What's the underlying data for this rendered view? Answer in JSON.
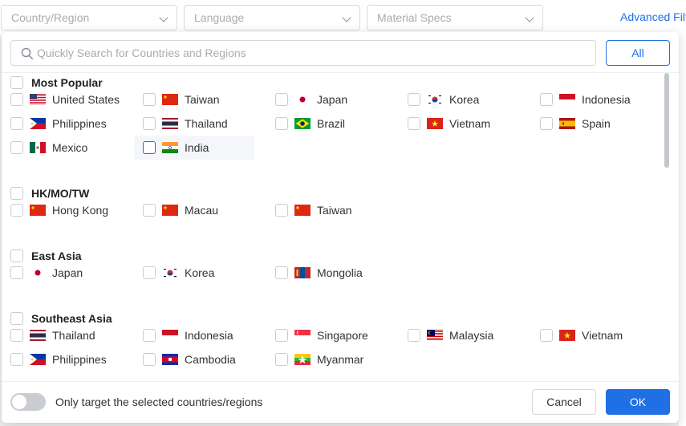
{
  "filters": {
    "country_region": "Country/Region",
    "language": "Language",
    "material_specs": "Material Specs",
    "advanced": "Advanced Filt"
  },
  "popup": {
    "search_placeholder": "Quickly Search for Countries and Regions",
    "all_label": "All",
    "groups": [
      {
        "title": "Most Popular",
        "items": [
          {
            "label": "United States",
            "flag": "us"
          },
          {
            "label": "Taiwan",
            "flag": "red-star"
          },
          {
            "label": "Japan",
            "flag": "jp"
          },
          {
            "label": "Korea",
            "flag": "kr"
          },
          {
            "label": "Indonesia",
            "flag": "id"
          },
          {
            "label": "Philippines",
            "flag": "ph"
          },
          {
            "label": "Thailand",
            "flag": "th"
          },
          {
            "label": "Brazil",
            "flag": "br"
          },
          {
            "label": "Vietnam",
            "flag": "vn"
          },
          {
            "label": "Spain",
            "flag": "es"
          },
          {
            "label": "Mexico",
            "flag": "mx"
          },
          {
            "label": "India",
            "flag": "in"
          }
        ]
      },
      {
        "title": "HK/MO/TW",
        "items": [
          {
            "label": "Hong Kong",
            "flag": "red-star"
          },
          {
            "label": "Macau",
            "flag": "red-star"
          },
          {
            "label": "Taiwan",
            "flag": "red-star"
          }
        ]
      },
      {
        "title": "East Asia",
        "items": [
          {
            "label": "Japan",
            "flag": "jp"
          },
          {
            "label": "Korea",
            "flag": "kr"
          },
          {
            "label": "Mongolia",
            "flag": "mn"
          }
        ]
      },
      {
        "title": "Southeast Asia",
        "items": [
          {
            "label": "Thailand",
            "flag": "th"
          },
          {
            "label": "Indonesia",
            "flag": "id"
          },
          {
            "label": "Singapore",
            "flag": "sg"
          },
          {
            "label": "Malaysia",
            "flag": "my"
          },
          {
            "label": "Vietnam",
            "flag": "vn"
          },
          {
            "label": "Philippines",
            "flag": "ph"
          },
          {
            "label": "Cambodia",
            "flag": "kh"
          },
          {
            "label": "Myanmar",
            "flag": "mm"
          }
        ]
      }
    ],
    "toggle_label": "Only target the selected countries/regions",
    "cancel_label": "Cancel",
    "ok_label": "OK"
  },
  "colors": {
    "accent": "#1f6fe5",
    "border": "#d9d9d9",
    "placeholder": "#a8abb2"
  }
}
